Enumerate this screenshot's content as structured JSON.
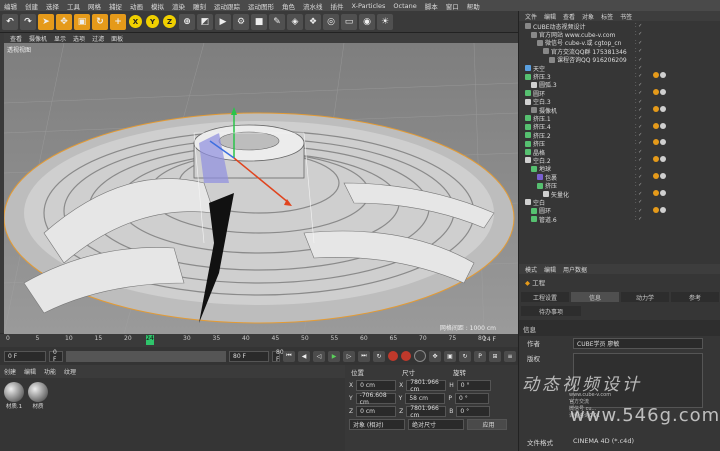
{
  "menus": [
    "编辑",
    "创建",
    "选择",
    "工具",
    "网格",
    "捕捉",
    "动画",
    "模拟",
    "渲染",
    "雕刻",
    "运动跟踪",
    "运动图形",
    "角色",
    "流水线",
    "插件",
    "X-Particles",
    "Octane",
    "脚本",
    "窗口",
    "帮助"
  ],
  "toolbar": {
    "xyz": [
      "X",
      "Y",
      "Z"
    ]
  },
  "viewport": {
    "menu": [
      "查看",
      "摄像机",
      "显示",
      "选项",
      "过滤",
      "面板"
    ],
    "label": "透视视图",
    "grid_info": "网格间距 : 1000 cm"
  },
  "timeline": {
    "ticks": [
      "0",
      "5",
      "10",
      "15",
      "20",
      "24",
      "30",
      "35",
      "40",
      "45",
      "50",
      "55",
      "60",
      "65",
      "70",
      "75",
      "80"
    ],
    "current": "24",
    "end_label": "24 F"
  },
  "playback": {
    "start": "0 F",
    "start2": "0 F",
    "end": "80 F",
    "end2": "80 F"
  },
  "material": {
    "menu": [
      "创建",
      "编辑",
      "功能",
      "纹理"
    ],
    "items": [
      "材质.1",
      "材质"
    ]
  },
  "coordinates": {
    "headers": [
      "位置",
      "尺寸",
      "旋转"
    ],
    "rows": [
      {
        "axis": "X",
        "pos": "0 cm",
        "size": "7801.966 cm",
        "rotlabel": "H",
        "rot": "0 °"
      },
      {
        "axis": "Y",
        "pos": "-706.608 cm",
        "size": "58 cm",
        "rotlabel": "P",
        "rot": "0 °"
      },
      {
        "axis": "Z",
        "pos": "0 cm",
        "size": "7801.966 cm",
        "rotlabel": "B",
        "rot": "0 °"
      }
    ],
    "mode1": "对象 (相对)",
    "mode2": "绝对尺寸",
    "apply": "应用"
  },
  "object_manager": {
    "menu": [
      "文件",
      "编辑",
      "查看",
      "对象",
      "标签",
      "书签"
    ],
    "rows": [
      {
        "indent": 0,
        "label": "CUBE动态视频设计",
        "icon": "#888888"
      },
      {
        "indent": 1,
        "label": "官方网站 www.cube-v.com",
        "icon": "#888888"
      },
      {
        "indent": 2,
        "label": "微信号 cube-v.或 cgtop_cn",
        "icon": "#888888"
      },
      {
        "indent": 3,
        "label": "官方交流QQ群 175381346",
        "icon": "#888888"
      },
      {
        "indent": 4,
        "label": "课程咨询QQ  916206209",
        "icon": "#888888"
      },
      {
        "indent": 0,
        "label": "天空",
        "icon": "#5aa0e0"
      },
      {
        "indent": 0,
        "label": "挤压.3",
        "icon": "#56c070"
      },
      {
        "indent": 1,
        "label": "圆弧.3",
        "icon": "#d0d0d0"
      },
      {
        "indent": 0,
        "label": "圆环",
        "icon": "#56c070"
      },
      {
        "indent": 0,
        "label": "空白.3",
        "icon": "#d0d0d0"
      },
      {
        "indent": 1,
        "label": "摄像机",
        "icon": "#888888"
      },
      {
        "indent": 0,
        "label": "挤压.1",
        "icon": "#56c070"
      },
      {
        "indent": 0,
        "label": "挤压.4",
        "icon": "#56c070"
      },
      {
        "indent": 0,
        "label": "挤压.2",
        "icon": "#56c070"
      },
      {
        "indent": 0,
        "label": "挤压",
        "icon": "#56c070"
      },
      {
        "indent": 0,
        "label": "晶格",
        "icon": "#56c070"
      },
      {
        "indent": 0,
        "label": "空白.2",
        "icon": "#d0d0d0"
      },
      {
        "indent": 1,
        "label": "地球",
        "icon": "#56c070"
      },
      {
        "indent": 2,
        "label": "包裹",
        "icon": "#7a60d0"
      },
      {
        "indent": 2,
        "label": "挤压",
        "icon": "#56c070"
      },
      {
        "indent": 3,
        "label": "矢量化",
        "icon": "#d0d0d0"
      },
      {
        "indent": 0,
        "label": "空白",
        "icon": "#d0d0d0"
      },
      {
        "indent": 1,
        "label": "圆环",
        "icon": "#56c070"
      },
      {
        "indent": 1,
        "label": "管道.6",
        "icon": "#56c070"
      }
    ]
  },
  "attributes": {
    "menu": [
      "模式",
      "编辑",
      "用户数据"
    ],
    "object": "工程",
    "tabs": [
      "工程设置",
      "信息",
      "动力学",
      "参考",
      "待办事项"
    ],
    "active_tab": "信息",
    "section": "信息",
    "rows": [
      {
        "k": "作者",
        "v": "CUBE学员  廖敏"
      },
      {
        "k": "版权",
        "v": ""
      },
      {
        "k": "文件格式",
        "v": "CINEMA 4D (*.c4d)"
      }
    ],
    "small_text": [
      "www.cube-v.com",
      "官方交流",
      "微信号 cu...",
      "课程咨询QQ1"
    ]
  },
  "watermark": {
    "line1": "动态视频设计",
    "line2": "www.546g.com"
  },
  "colors": {
    "accent_orange": "#e59a1a",
    "viewport_bg": "#8e8e8e"
  }
}
